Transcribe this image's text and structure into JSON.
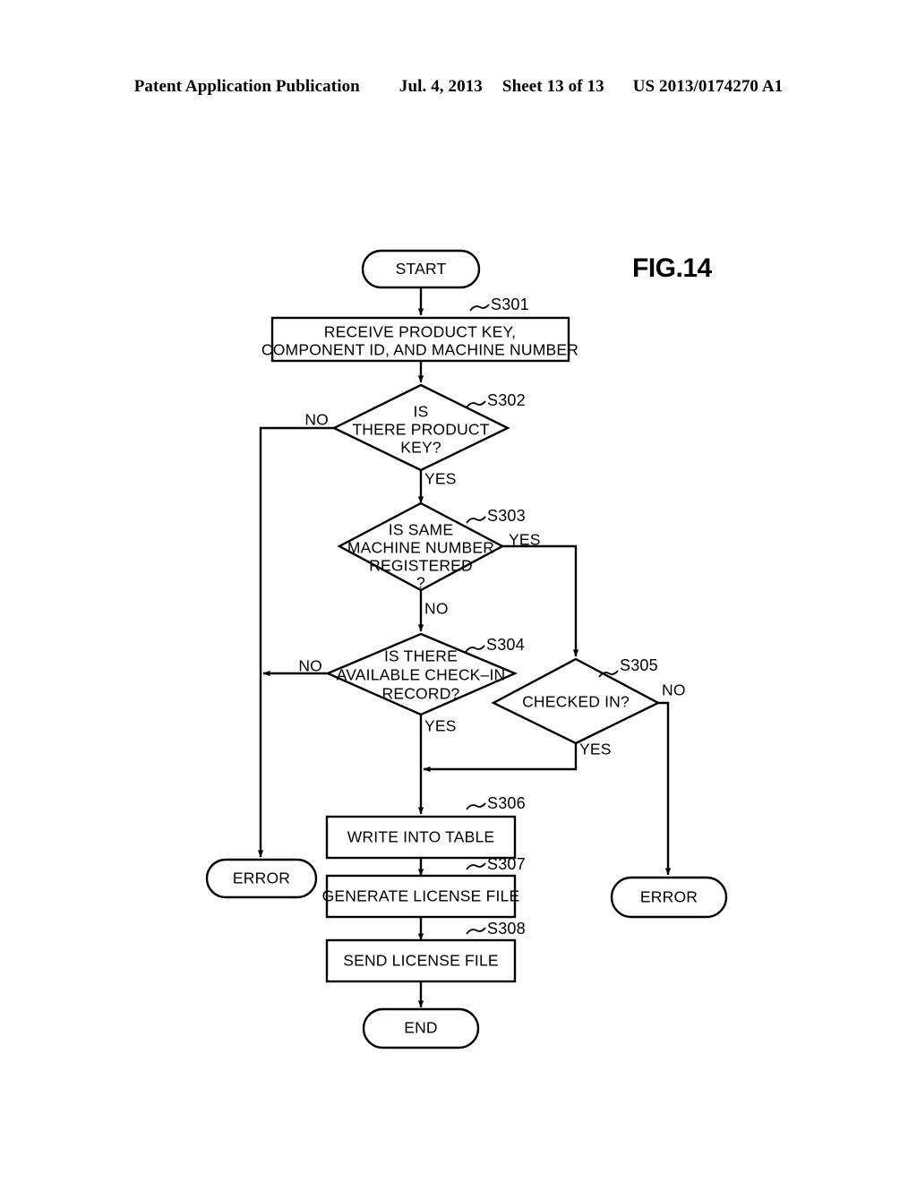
{
  "header": {
    "publication": "Patent Application Publication",
    "date": "Jul. 4, 2013",
    "sheet": "Sheet 13 of 13",
    "patent_number": "US 2013/0174270 A1"
  },
  "figure": {
    "label": "FIG.14"
  },
  "colors": {
    "ink": "#000000",
    "paper": "#ffffff"
  },
  "nodes": {
    "start": {
      "label": "START"
    },
    "s301": {
      "step": "S301",
      "line1": "RECEIVE PRODUCT KEY,",
      "line2": "COMPONENT ID, AND MACHINE NUMBER"
    },
    "s302": {
      "step": "S302",
      "line1": "IS",
      "line2": "THERE PRODUCT",
      "line3": "KEY?",
      "yes": "YES",
      "no": "NO"
    },
    "s303": {
      "step": "S303",
      "line1": "IS SAME",
      "line2": "MACHINE NUMBER",
      "line3": "REGISTERED",
      "line4": "?",
      "yes": "YES",
      "no": "NO"
    },
    "s304": {
      "step": "S304",
      "line1": "IS THERE",
      "line2": "AVAILABLE CHECK–IN",
      "line3": "RECORD?",
      "yes": "YES",
      "no": "NO"
    },
    "s305": {
      "step": "S305",
      "line1": "CHECKED IN?",
      "yes": "YES",
      "no": "NO"
    },
    "s306": {
      "step": "S306",
      "line1": "WRITE INTO TABLE"
    },
    "s307": {
      "step": "S307",
      "line1": "GENERATE LICENSE FILE"
    },
    "s308": {
      "step": "S308",
      "line1": "SEND LICENSE FILE"
    },
    "error_left": {
      "label": "ERROR"
    },
    "error_right": {
      "label": "ERROR"
    },
    "end": {
      "label": "END"
    }
  },
  "chart_data": {
    "type": "diagram",
    "title": "FIG.14",
    "diagram_kind": "flowchart",
    "steps": [
      {
        "id": "START",
        "shape": "terminator",
        "text": "START"
      },
      {
        "id": "S301",
        "shape": "process",
        "text": "RECEIVE PRODUCT KEY, COMPONENT ID, AND MACHINE NUMBER"
      },
      {
        "id": "S302",
        "shape": "decision",
        "text": "IS THERE PRODUCT KEY?"
      },
      {
        "id": "S303",
        "shape": "decision",
        "text": "IS SAME MACHINE NUMBER REGISTERED ?"
      },
      {
        "id": "S304",
        "shape": "decision",
        "text": "IS THERE AVAILABLE CHECK-IN RECORD?"
      },
      {
        "id": "S305",
        "shape": "decision",
        "text": "CHECKED IN?"
      },
      {
        "id": "S306",
        "shape": "process",
        "text": "WRITE INTO TABLE"
      },
      {
        "id": "S307",
        "shape": "process",
        "text": "GENERATE LICENSE FILE"
      },
      {
        "id": "S308",
        "shape": "process",
        "text": "SEND LICENSE FILE"
      },
      {
        "id": "ERROR_LEFT",
        "shape": "terminator",
        "text": "ERROR"
      },
      {
        "id": "ERROR_RIGHT",
        "shape": "terminator",
        "text": "ERROR"
      },
      {
        "id": "END",
        "shape": "terminator",
        "text": "END"
      }
    ],
    "edges": [
      {
        "from": "START",
        "to": "S301",
        "label": ""
      },
      {
        "from": "S301",
        "to": "S302",
        "label": ""
      },
      {
        "from": "S302",
        "to": "ERROR_LEFT",
        "label": "NO"
      },
      {
        "from": "S302",
        "to": "S303",
        "label": "YES"
      },
      {
        "from": "S303",
        "to": "S305",
        "label": "YES"
      },
      {
        "from": "S303",
        "to": "S304",
        "label": "NO"
      },
      {
        "from": "S304",
        "to": "ERROR_LEFT",
        "label": "NO"
      },
      {
        "from": "S304",
        "to": "S306",
        "label": "YES"
      },
      {
        "from": "S305",
        "to": "ERROR_RIGHT",
        "label": "NO"
      },
      {
        "from": "S305",
        "to": "S306",
        "label": "YES"
      },
      {
        "from": "S306",
        "to": "S307",
        "label": ""
      },
      {
        "from": "S307",
        "to": "S308",
        "label": ""
      },
      {
        "from": "S308",
        "to": "END",
        "label": ""
      }
    ]
  }
}
